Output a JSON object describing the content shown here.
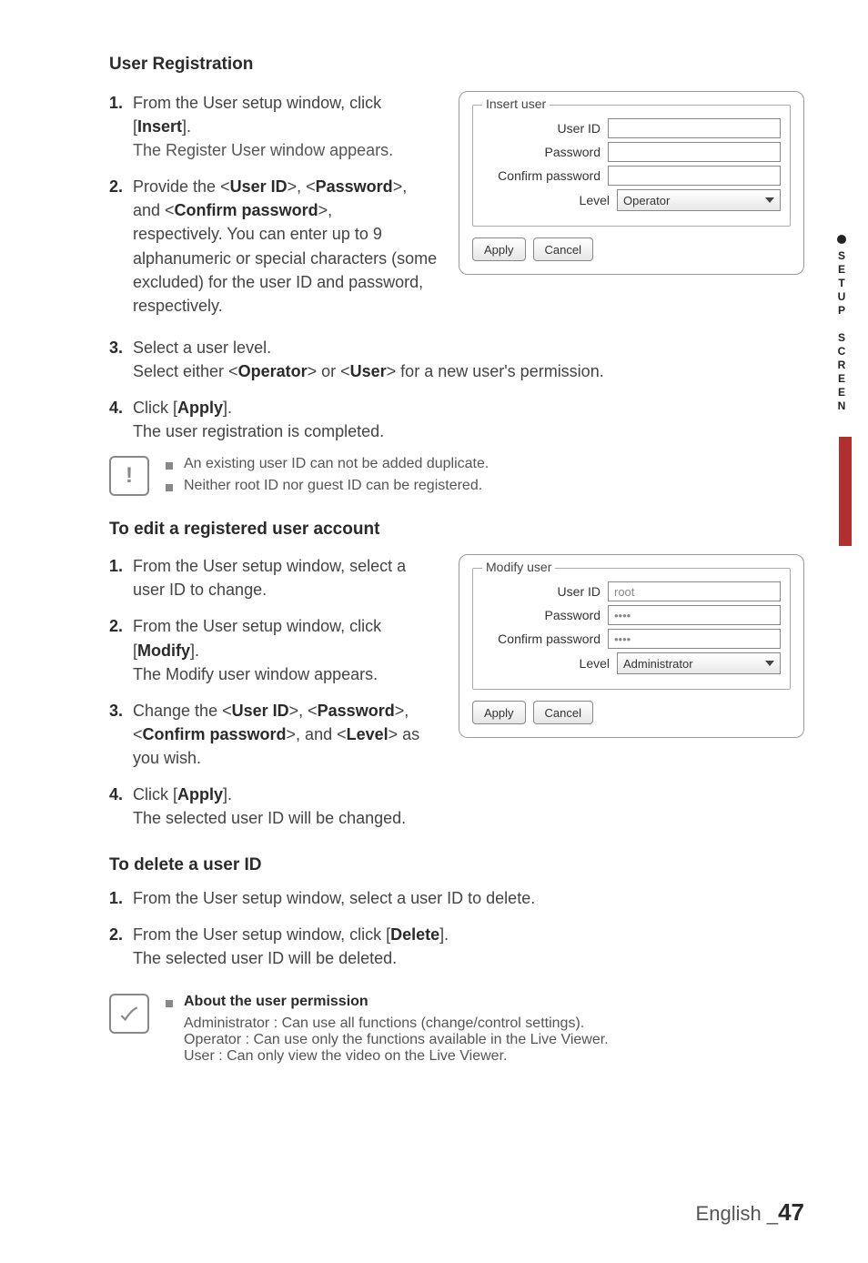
{
  "sidetab": {
    "label": "SETUP SCREEN"
  },
  "footer": {
    "lang": "English",
    "underscore": "_",
    "page": "47"
  },
  "section1": {
    "title": "User Registration",
    "items": [
      {
        "n": "1.",
        "l1": "From the User setup window, click",
        "l2": "[",
        "b1": "Insert",
        "l3": "].",
        "l4": "The Register User window appears."
      },
      {
        "n": "2.",
        "l1": "Provide the <",
        "b1": "User ID",
        "l2": ">, <",
        "b2": "Password",
        "l3": ">,",
        "l4": "and <",
        "b3": "Confirm password",
        "l5": ">,",
        "l6": "respectively. You can enter up to 9 alphanumeric or special characters (some excluded) for the user ID and password, respectively."
      },
      {
        "n": "3.",
        "l1": "Select a user level.",
        "l2": "Select either <",
        "b1": "Operator",
        "l3": "> or <",
        "b2": "User",
        "l4": "> for a new user's permission."
      },
      {
        "n": "4.",
        "l1": "Click [",
        "b1": "Apply",
        "l2": "].",
        "l3": "The user registration is completed."
      }
    ],
    "notes": [
      "An existing user ID can not be added duplicate.",
      "Neither root ID nor guest ID can be registered."
    ]
  },
  "panel1": {
    "legend": "Insert user",
    "rows": [
      {
        "label": "User ID",
        "value": ""
      },
      {
        "label": "Password",
        "value": ""
      },
      {
        "label": "Confirm password",
        "value": ""
      }
    ],
    "levelLabel": "Level",
    "levelValue": "Operator",
    "apply": "Apply",
    "cancel": "Cancel"
  },
  "section2": {
    "title": "To edit a registered user account",
    "items": [
      {
        "n": "1.",
        "l1": "From the User setup window, select a user ID to change."
      },
      {
        "n": "2.",
        "l1": "From the User setup window, click",
        "l2": "[",
        "b1": "Modify",
        "l3": "].",
        "l4": "The Modify user window appears."
      },
      {
        "n": "3.",
        "l1": "Change the <",
        "b1": "User ID",
        "l2": ">, <",
        "b2": "Password",
        "l3": ">,",
        "l4": "<",
        "b3": "Confirm password",
        "l5": ">, and <",
        "b4": "Level",
        "l6": "> as",
        "l7": "you wish."
      },
      {
        "n": "4.",
        "l1": "Click [",
        "b1": "Apply",
        "l2": "].",
        "l3": "The selected user ID will be changed."
      }
    ]
  },
  "panel2": {
    "legend": "Modify user",
    "rows": [
      {
        "label": "User ID",
        "value": "root"
      },
      {
        "label": "Password",
        "value": "••••"
      },
      {
        "label": "Confirm password",
        "value": "••••"
      }
    ],
    "levelLabel": "Level",
    "levelValue": "Administrator",
    "apply": "Apply",
    "cancel": "Cancel"
  },
  "section3": {
    "title": "To delete a user ID",
    "items": [
      {
        "n": "1.",
        "l1": "From the User setup window, select a user ID to delete."
      },
      {
        "n": "2.",
        "l1": "From the User setup window, click [",
        "b1": "Delete",
        "l2": "].",
        "l3": "The selected user ID will be deleted."
      }
    ]
  },
  "section4": {
    "title": "About the user permission",
    "lines": [
      "Administrator : Can use all functions (change/control settings).",
      "Operator : Can use only the functions available in the Live Viewer.",
      "User : Can only view the video on the Live Viewer."
    ]
  }
}
